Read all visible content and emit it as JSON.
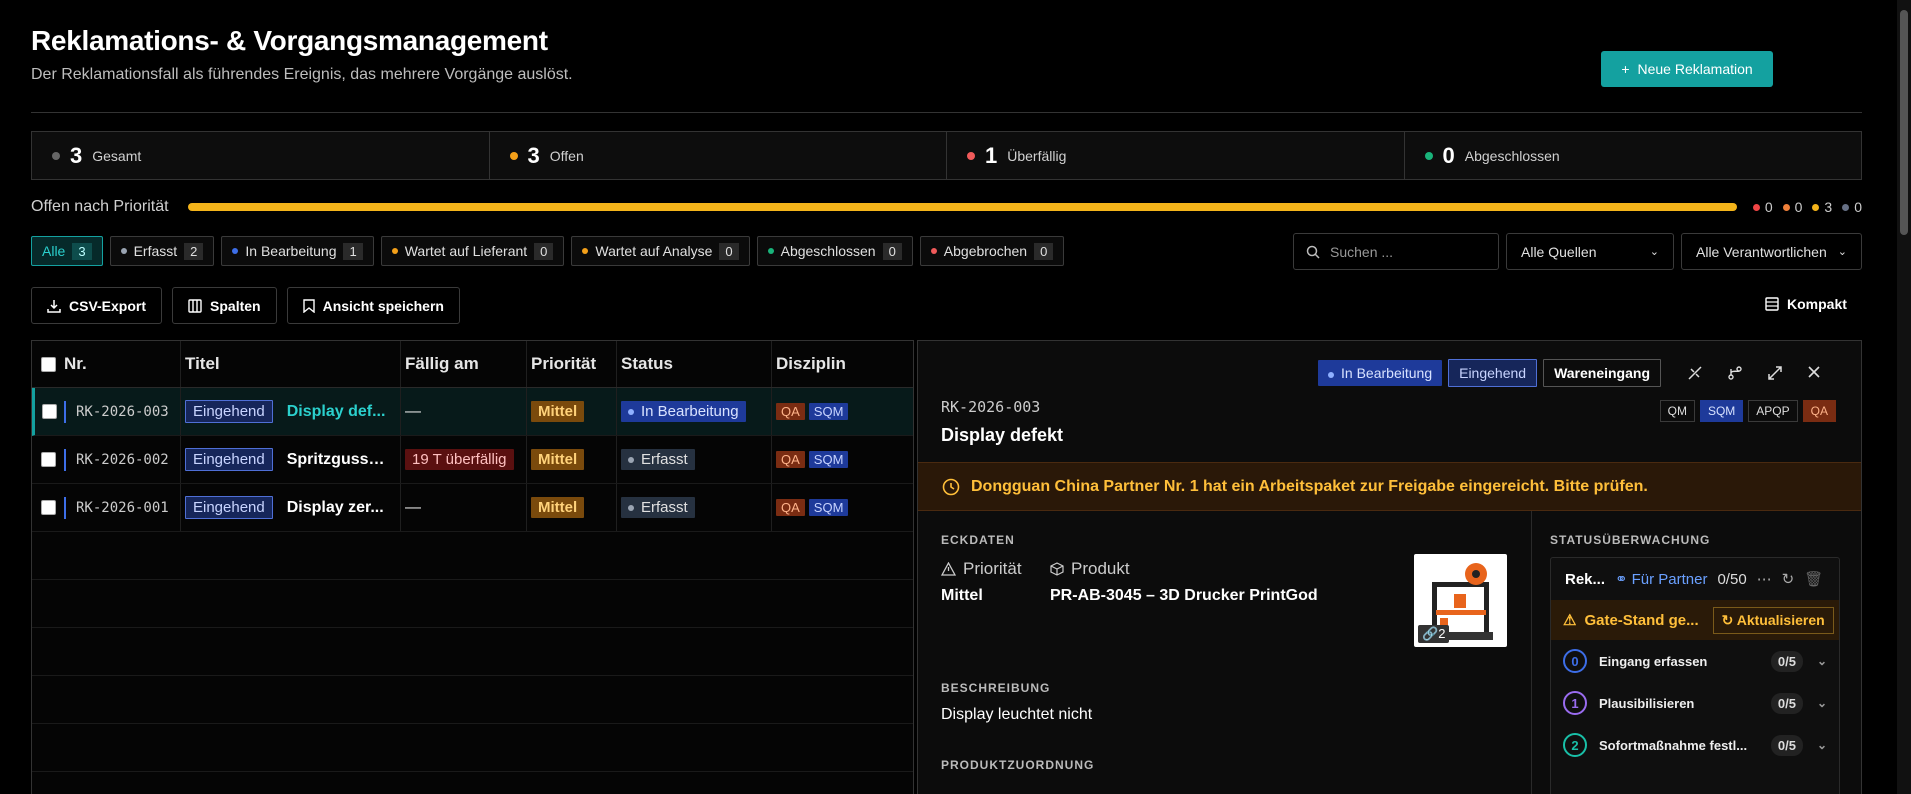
{
  "page": {
    "title": "Reklamations- & Vorgangsmanagement",
    "subtitle": "Der Reklamationsfall als führendes Ereignis, das mehrere Vorgänge auslöst.",
    "new_button": "Neue Reklamation"
  },
  "stats": [
    {
      "value": "3",
      "label": "Gesamt",
      "color": "#666666"
    },
    {
      "value": "3",
      "label": "Offen",
      "color": "#f4a019"
    },
    {
      "value": "1",
      "label": "Überfällig",
      "color": "#f05a5a"
    },
    {
      "value": "0",
      "label": "Abgeschlossen",
      "color": "#19b37a"
    }
  ],
  "priority": {
    "label": "Offen nach Priorität",
    "legend": [
      {
        "value": "0",
        "color": "#f04545"
      },
      {
        "value": "0",
        "color": "#f0803a"
      },
      {
        "value": "3",
        "color": "#f4b41a"
      },
      {
        "value": "0",
        "color": "#667085"
      }
    ]
  },
  "filters": [
    {
      "label": "Alle",
      "count": "3",
      "dot": ""
    },
    {
      "label": "Erfasst",
      "count": "2",
      "dot": "#9aa4b2"
    },
    {
      "label": "In Bearbeitung",
      "count": "1",
      "dot": "#3d6ee8"
    },
    {
      "label": "Wartet auf Lieferant",
      "count": "0",
      "dot": "#f4a019"
    },
    {
      "label": "Wartet auf Analyse",
      "count": "0",
      "dot": "#f4a019"
    },
    {
      "label": "Abgeschlossen",
      "count": "0",
      "dot": "#19b37a"
    },
    {
      "label": "Abgebrochen",
      "count": "0",
      "dot": "#f05a5a"
    }
  ],
  "search": {
    "placeholder": "Suchen ..."
  },
  "selects": {
    "sources": "Alle Quellen",
    "owners": "Alle Verantwortlichen"
  },
  "toolbar": {
    "csv": "CSV-Export",
    "columns": "Spalten",
    "save_view": "Ansicht speichern",
    "compact": "Kompakt"
  },
  "table": {
    "headers": {
      "nr": "Nr.",
      "title": "Titel",
      "due": "Fällig am",
      "priority": "Priorität",
      "status": "Status",
      "discipline": "Disziplin"
    },
    "rows": [
      {
        "nr": "RK-2026-003",
        "source": "Eingehend",
        "title": "Display def...",
        "due": "—",
        "priority": "Mittel",
        "status": "In Bearbeitung",
        "disc": [
          "QA",
          "SQM"
        ]
      },
      {
        "nr": "RK-2026-002",
        "source": "Eingehend",
        "title": "Spritzgusst...",
        "due": "19 T überfällig",
        "priority": "Mittel",
        "status": "Erfasst",
        "disc": [
          "QA",
          "SQM"
        ]
      },
      {
        "nr": "RK-2026-001",
        "source": "Eingehend",
        "title": "Display zer...",
        "due": "—",
        "priority": "Mittel",
        "status": "Erfasst",
        "disc": [
          "QA",
          "SQM"
        ]
      }
    ]
  },
  "detail": {
    "badges": {
      "status": "In Bearbeitung",
      "source": "Eingehend",
      "area": "Wareneingang"
    },
    "id": "RK-2026-003",
    "title": "Display defekt",
    "tags": [
      "QM",
      "SQM",
      "APQP",
      "QA"
    ],
    "alert": "Dongguan China Partner Nr. 1 hat ein Arbeitspaket zur Freigabe eingereicht. Bitte prüfen.",
    "eckdaten": "ECKDATEN",
    "prio_label": "Priorität",
    "prio_value": "Mittel",
    "product_label": "Produkt",
    "product_value": "PR-AB-3045 – 3D Drucker PrintGod",
    "image_count": "2",
    "desc_label": "BESCHREIBUNG",
    "desc_value": "Display leuchtet nicht",
    "prod_assign": "PRODUKTZUORDNUNG"
  },
  "monitor": {
    "heading": "STATUSÜBERWACHUNG",
    "name": "Rek...",
    "partner": "Für Partner",
    "progress": "0/50",
    "warn": "Gate-Stand ge...",
    "refresh": "Aktualisieren",
    "steps": [
      {
        "n": "0",
        "label": "Eingang erfassen",
        "count": "0/5",
        "color": "#3d6ee8"
      },
      {
        "n": "1",
        "label": "Plausibilisieren",
        "count": "0/5",
        "color": "#9a6cf0"
      },
      {
        "n": "2",
        "label": "Sofortmaßnahme festl...",
        "count": "0/5",
        "color": "#19c0a8"
      }
    ]
  }
}
